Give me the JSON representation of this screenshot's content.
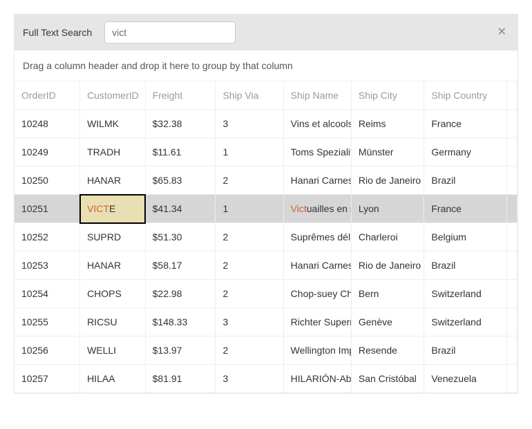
{
  "toolbar": {
    "label": "Full Text Search",
    "search_value": "vict",
    "close_glyph": "✕"
  },
  "group_bar": {
    "hint": "Drag a column header and drop it here to group by that column"
  },
  "columns": [
    "OrderID",
    "CustomerID",
    "Freight",
    "Ship Via",
    "Ship Name",
    "Ship City",
    "Ship Country"
  ],
  "search_term": "vict",
  "highlight_cell": {
    "row": 3,
    "col": 1
  },
  "rows": [
    {
      "cells": [
        "10248",
        "WILMK",
        "$32.38",
        "3",
        "Vins et alcools Chevalier",
        "Reims",
        "France"
      ]
    },
    {
      "cells": [
        "10249",
        "TRADH",
        "$11.61",
        "1",
        "Toms Spezialitäten",
        "Münster",
        "Germany"
      ]
    },
    {
      "cells": [
        "10250",
        "HANAR",
        "$65.83",
        "2",
        "Hanari Carnes",
        "Rio de Janeiro",
        "Brazil"
      ]
    },
    {
      "cells": [
        "10251",
        "VICTE",
        "$41.34",
        "1",
        "Victuailles en stock",
        "Lyon",
        "France"
      ],
      "highlight": true
    },
    {
      "cells": [
        "10252",
        "SUPRD",
        "$51.30",
        "2",
        "Suprêmes délices",
        "Charleroi",
        "Belgium"
      ]
    },
    {
      "cells": [
        "10253",
        "HANAR",
        "$58.17",
        "2",
        "Hanari Carnes",
        "Rio de Janeiro",
        "Brazil"
      ]
    },
    {
      "cells": [
        "10254",
        "CHOPS",
        "$22.98",
        "2",
        "Chop-suey Chinese",
        "Bern",
        "Switzerland"
      ]
    },
    {
      "cells": [
        "10255",
        "RICSU",
        "$148.33",
        "3",
        "Richter Supermarkt",
        "Genève",
        "Switzerland"
      ]
    },
    {
      "cells": [
        "10256",
        "WELLI",
        "$13.97",
        "2",
        "Wellington Importadora",
        "Resende",
        "Brazil"
      ]
    },
    {
      "cells": [
        "10257",
        "HILAA",
        "$81.91",
        "3",
        "HILARIÓN-Abastos",
        "San Cristóbal",
        "Venezuela"
      ]
    }
  ]
}
